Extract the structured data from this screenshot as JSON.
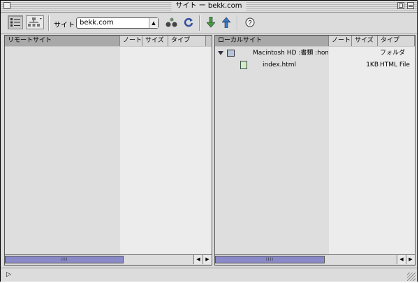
{
  "window": {
    "title": "サイト ー bekk.com"
  },
  "toolbar": {
    "site_label": "サイト :",
    "site_value": "bekk.com",
    "help_symbol": "?"
  },
  "left_pane": {
    "columns": [
      "リモートサイト",
      "ノート",
      "サイズ",
      "タイプ"
    ]
  },
  "right_pane": {
    "columns": [
      "ローカルサイト",
      "ノート",
      "サイズ",
      "タイプ"
    ],
    "rows": [
      {
        "name": "Macintosh HD :書類 :hom...",
        "note": "",
        "size": "",
        "type": "フォルダ",
        "icon": "folder-icon",
        "expanded": true
      },
      {
        "name": "index.html",
        "note": "",
        "size": "1KB",
        "type": "HTML File",
        "icon": "html-file-icon"
      }
    ]
  },
  "scrollbar": {
    "thumb_marks": "IIII"
  }
}
